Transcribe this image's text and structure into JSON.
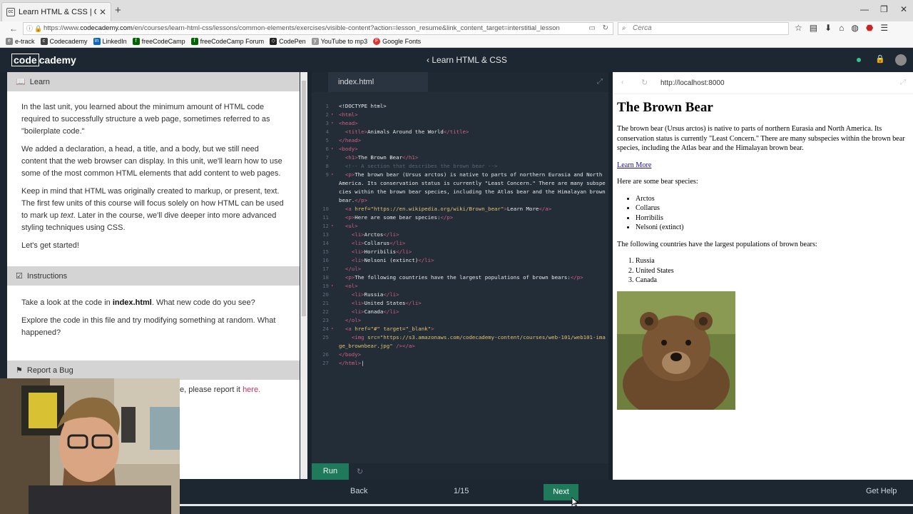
{
  "browser": {
    "tab_title": "Learn HTML & CSS | Codeca",
    "tab_close": "✕",
    "new_tab": "+",
    "url_prefix": "https://www.",
    "url_domain": "codecademy.com",
    "url_path": "/en/courses/learn-html-css/lessons/common-elements/exercises/visible-content?action=lesson_resume&link_content_target=interstitial_lesson",
    "search_placeholder": "Cerca",
    "bookmarks": [
      "e-track",
      "Codecademy",
      "LinkedIn",
      "freeCodeCamp",
      "freeCodeCamp Forum",
      "CodePen",
      "YouTube to mp3",
      "Google Fonts"
    ]
  },
  "header": {
    "logo_a": "code",
    "logo_b": "cademy",
    "course_title": "Learn HTML & CSS"
  },
  "learn": {
    "heading": "Learn",
    "p1": "In the last unit, you learned about the minimum amount of HTML code required to successfully structure a web page, sometimes referred to as \"boilerplate code.\"",
    "p2": "We added a declaration, a head, a title, and a body, but we still need content that the web browser can display. In this unit, we'll learn how to use some of the most common HTML elements that add content to web pages.",
    "p3a": "Keep in mind that HTML was originally created to markup, or present, text. The first few units of this course will focus solely on how HTML can be used to mark up ",
    "p3em": "text",
    "p3b": ". Later in the course, we'll dive deeper into more advanced styling techniques using CSS.",
    "p4": "Let's get started!"
  },
  "instructions": {
    "heading": "Instructions",
    "p1a": "Take a look at the code in ",
    "p1b": "index.html",
    "p1c": ". What new code do you see?",
    "p2": "Explore the code in this file and try modifying something at random. What happened?"
  },
  "report": {
    "heading": "Report a Bug",
    "text": "e, please report it ",
    "link": "here."
  },
  "editor": {
    "tab": "index.html",
    "run": "Run"
  },
  "preview": {
    "url": "http://localhost:8000",
    "h1": "The Brown Bear",
    "p1": "The brown bear (Ursus arctos) is native to parts of northern Eurasia and North America. Its conservation status is currently \"Least Concern.\" There are many subspecies within the brown bear species, including the Atlas bear and the Himalayan brown bear.",
    "link": "Learn More",
    "p2": "Here are some bear species:",
    "species": [
      "Arctos",
      "Collarus",
      "Horribilis",
      "Nelsoni (extinct)"
    ],
    "p3": "The following countries have the largest populations of brown bears:",
    "countries": [
      "Russia",
      "United States",
      "Canada"
    ]
  },
  "footer": {
    "back": "Back",
    "page": "1/15",
    "next": "Next",
    "help": "Get Help"
  }
}
